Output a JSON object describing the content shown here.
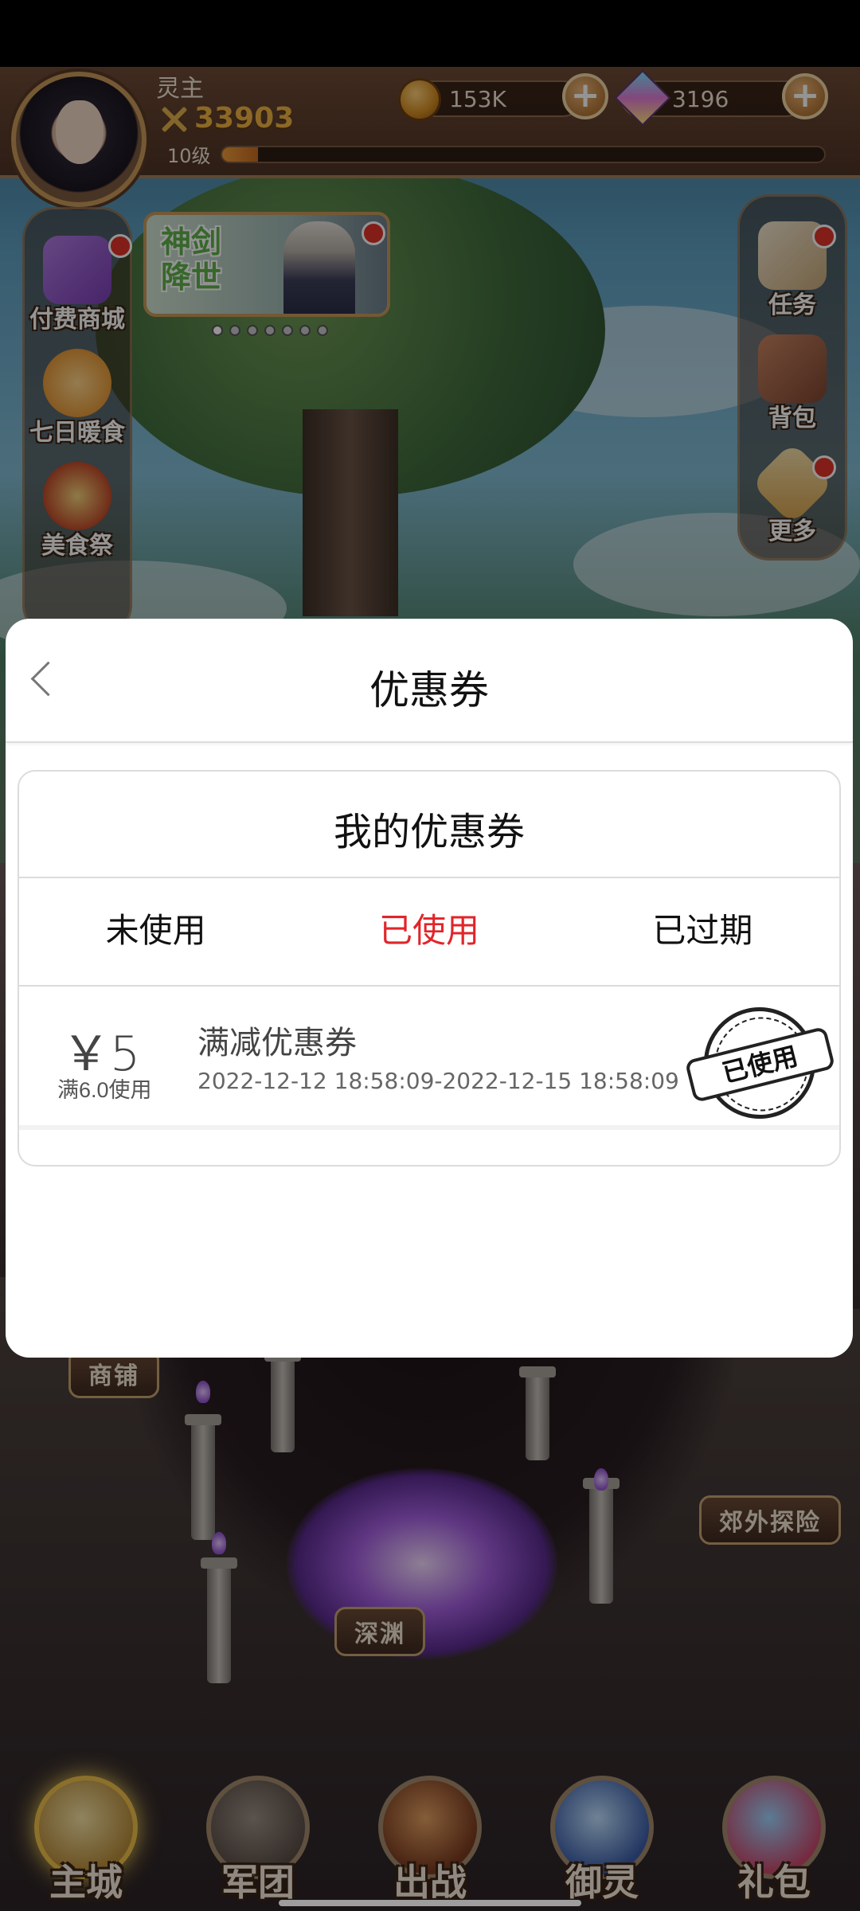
{
  "hud": {
    "player_name": "灵主",
    "power": "33903",
    "level": "10级",
    "exp_fraction": 0.06,
    "gold": "153K",
    "gems": "3196",
    "plus": "+"
  },
  "left_menu": [
    {
      "label": "付费商城",
      "icon": "gift-box-icon",
      "badge": true
    },
    {
      "label": "七日暖食",
      "icon": "tiger-icon",
      "badge": false
    },
    {
      "label": "美食祭",
      "icon": "food-bowl-icon",
      "badge": false
    }
  ],
  "right_menu": [
    {
      "label": "任务",
      "icon": "quest-scroll-icon",
      "badge": true
    },
    {
      "label": "背包",
      "icon": "backpack-icon",
      "badge": false
    },
    {
      "label": "更多",
      "icon": "more-grid-icon",
      "badge": true
    }
  ],
  "banner": {
    "title": "神剑\n降世",
    "dots": 7,
    "active_dot": 0
  },
  "map_labels": {
    "shop": "商铺",
    "abyss": "深渊",
    "explore": "郊外探险"
  },
  "bottom_nav": [
    {
      "label": "主城",
      "icon": "main-city-icon",
      "active": true
    },
    {
      "label": "军团",
      "icon": "legion-fist-icon",
      "active": false
    },
    {
      "label": "出战",
      "icon": "battle-sword-icon",
      "active": false
    },
    {
      "label": "御灵",
      "icon": "spirit-crystal-icon",
      "active": false
    },
    {
      "label": "礼包",
      "icon": "gift-shop-icon",
      "active": false
    }
  ],
  "modal": {
    "title": "优惠券",
    "back_icon": "chevron-left-icon",
    "card_title": "我的优惠券",
    "tabs": [
      {
        "label": "未使用",
        "active": false
      },
      {
        "label": "已使用",
        "active": true
      },
      {
        "label": "已过期",
        "active": false
      }
    ],
    "coupons": [
      {
        "amount": "￥5",
        "condition": "满6.0使用",
        "name": "满减优惠券",
        "dates": "2022-12-12 18:58:09-2022-12-15 18:58:09",
        "stamp": "已使用"
      }
    ]
  },
  "colors": {
    "active_tab": "#e1252a",
    "hud_brown": "#6e4a35",
    "power_gold": "#f0b343"
  }
}
